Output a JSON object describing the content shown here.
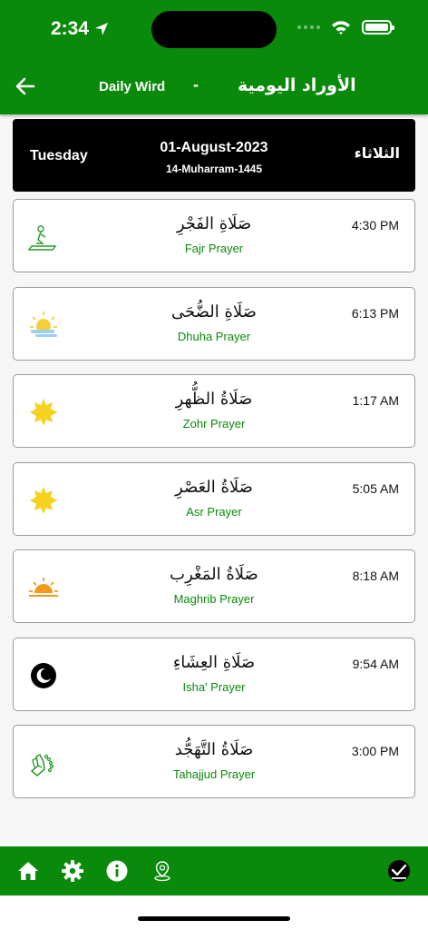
{
  "status_bar": {
    "time": "2:34"
  },
  "header": {
    "title_en": "Daily Wird",
    "separator": "-",
    "title_ar": "الأوراد اليومية"
  },
  "date_bar": {
    "day_en": "Tuesday",
    "gregorian_date": "01-August-2023",
    "hijri_date": "14-Muharram-1445",
    "day_ar": "الثلاثاء"
  },
  "prayers": [
    {
      "name_ar": "صَلَاةِ الفَجْرِ",
      "name_en": "Fajr Prayer",
      "time": "4:30 PM",
      "icon": "praying-person-icon"
    },
    {
      "name_ar": "صَلَاةِ الضُّحَى",
      "name_en": "Dhuha Prayer",
      "time": "6:13 PM",
      "icon": "sun-cloud-icon"
    },
    {
      "name_ar": "صَلَاةُ الظُّهرِ",
      "name_en": "Zohr Prayer",
      "time": "1:17 AM",
      "icon": "sun-icon"
    },
    {
      "name_ar": "صَلَاةُ العَصْرِ",
      "name_en": "Asr Prayer",
      "time": "5:05 AM",
      "icon": "sun-icon"
    },
    {
      "name_ar": "صَلَاةُ المَغْرِب",
      "name_en": "Maghrib Prayer",
      "time": "8:18 AM",
      "icon": "sunset-icon"
    },
    {
      "name_ar": "صَلَاةِ العِشَاءِ",
      "name_en": "Isha' Prayer",
      "time": "9:54 AM",
      "icon": "moon-icon"
    },
    {
      "name_ar": "صَلَاةُ التَّهَجُّد",
      "name_en": "Tahajjud Prayer",
      "time": "3:00 PM",
      "icon": "praying-hands-icon"
    }
  ],
  "bottom_nav": [
    "home-icon",
    "settings-icon",
    "info-icon",
    "location-pin-icon",
    "checkmark-icon"
  ],
  "colors": {
    "primary_green": "#0a8a0a",
    "date_bar_bg": "#000000",
    "sun_yellow": "#f5d21f",
    "sunset_orange": "#f39a1c"
  }
}
